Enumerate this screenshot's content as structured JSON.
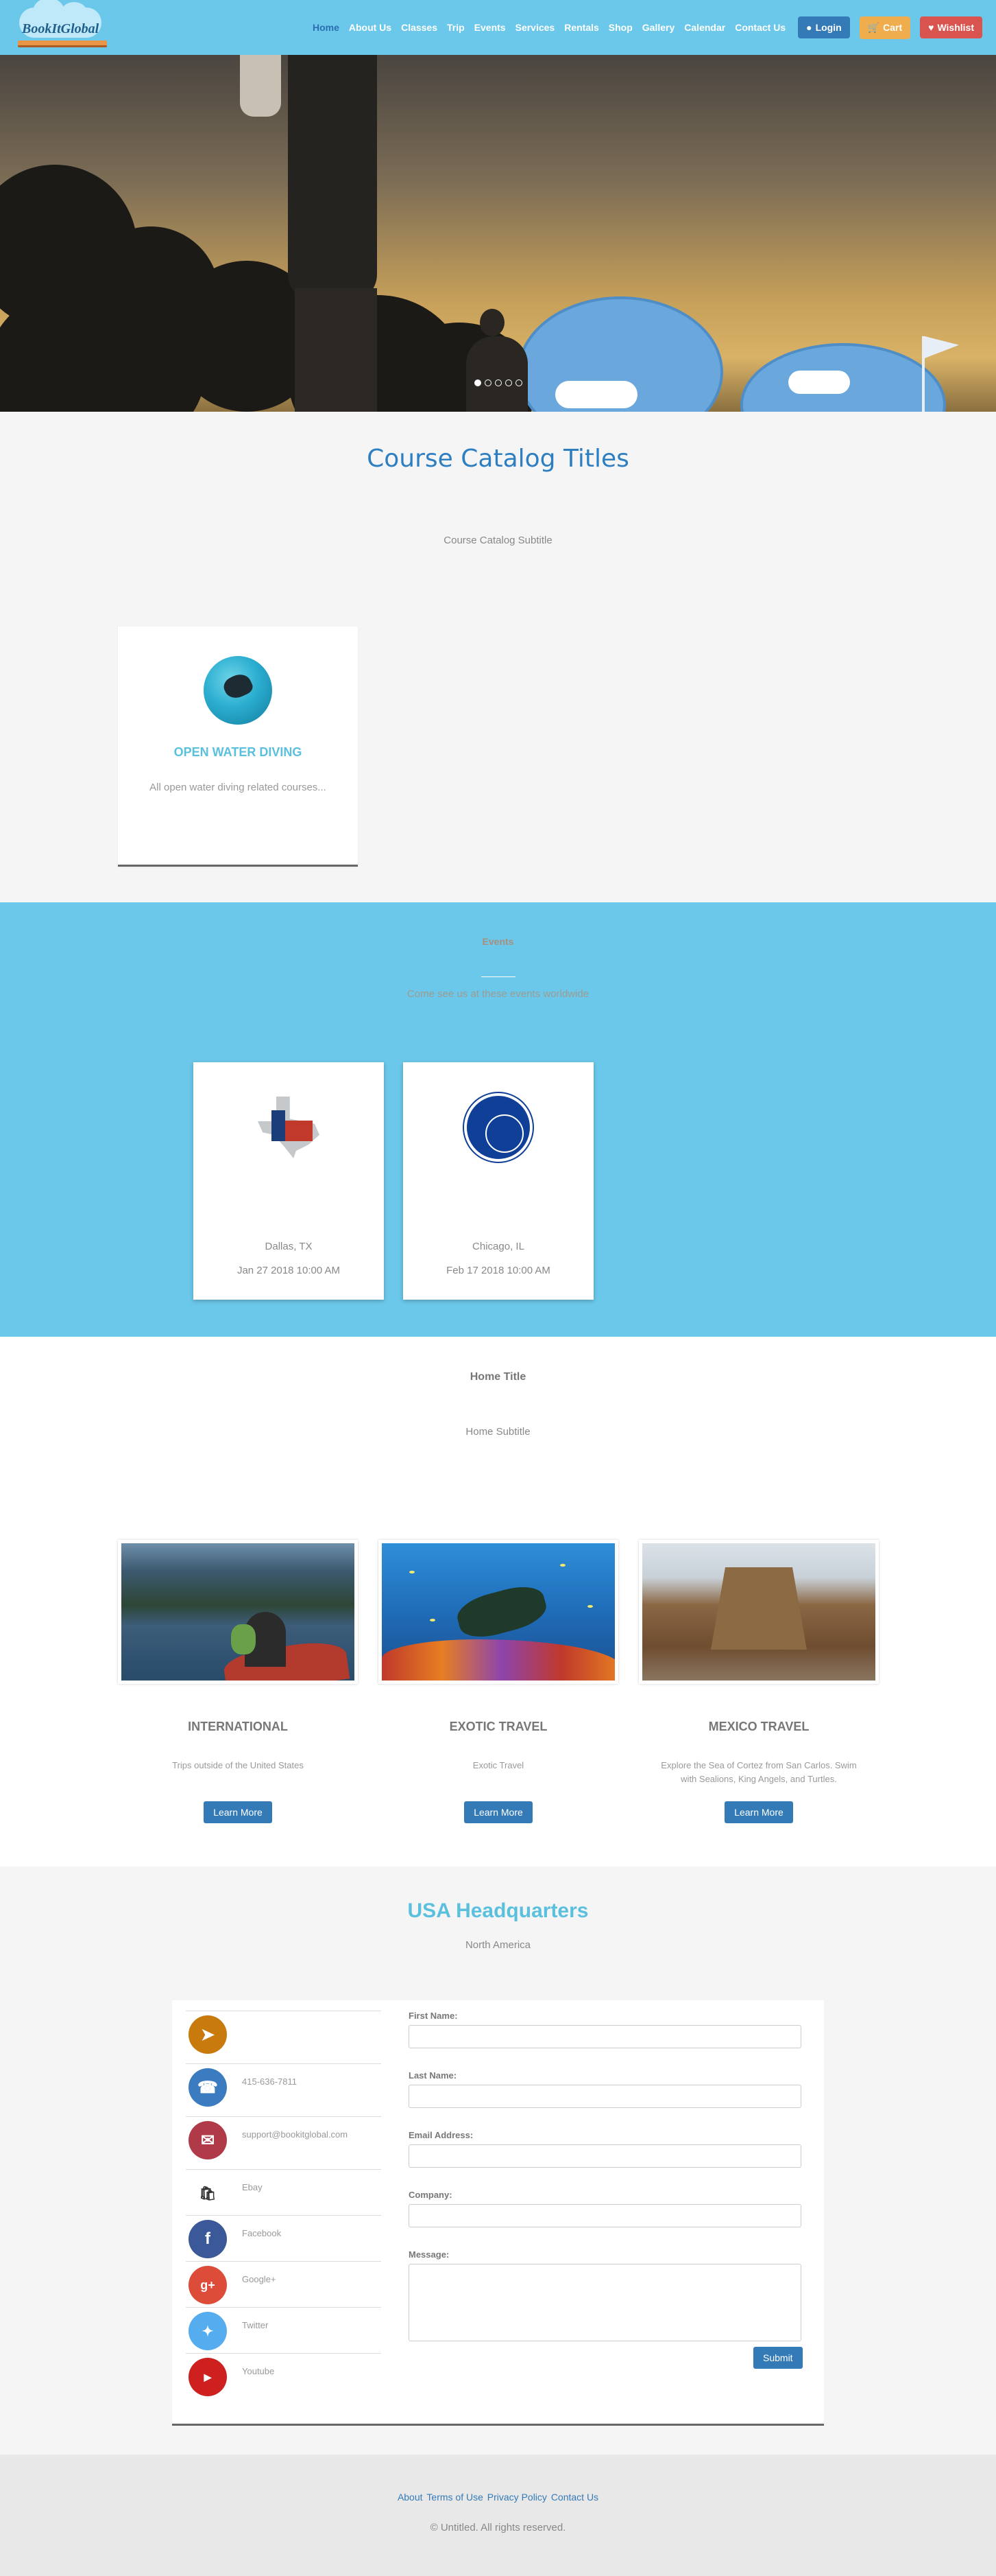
{
  "nav": {
    "logo_text": "BookItGlobal",
    "links": [
      "Home",
      "About Us",
      "Classes",
      "Trip",
      "Events",
      "Services",
      "Rentals",
      "Shop",
      "Gallery",
      "Calendar",
      "Contact Us"
    ],
    "login": "Login",
    "cart": "Cart",
    "wishlist": "Wishlist"
  },
  "catalog": {
    "title": "Course Catalog Titles",
    "subtitle": "Course Catalog Subtitle",
    "courses": [
      {
        "name": "OPEN WATER DIVING",
        "description": "All open water diving related courses..."
      }
    ]
  },
  "events": {
    "title": "Events",
    "subtitle": "Come see us at these events worldwide",
    "items": [
      {
        "city": "Dallas, TX",
        "date": "Jan 27 2018 10:00 AM"
      },
      {
        "city": "Chicago, IL",
        "date": "Feb 17 2018 10:00 AM"
      }
    ]
  },
  "home": {
    "title": "Home Title",
    "subtitle": "Home Subtitle",
    "items": [
      {
        "name": "INTERNATIONAL",
        "description": "Trips outside of the United States",
        "button": "Learn More"
      },
      {
        "name": "EXOTIC TRAVEL",
        "description": "Exotic Travel",
        "button": "Learn More"
      },
      {
        "name": "MEXICO TRAVEL",
        "description": "Explore the Sea of Cortez from San Carlos. Swim with Sealions, King Angels, and Turtles.",
        "button": "Learn More"
      }
    ]
  },
  "hq": {
    "title": "USA Headquarters",
    "subtitle": "North America",
    "contacts": [
      {
        "icon": "location-arrow-icon",
        "text": "",
        "color": "#e68a00"
      },
      {
        "icon": "phone-icon",
        "text": "415-636-7811",
        "color": "#3b7bbf"
      },
      {
        "icon": "envelope-icon",
        "text": "support@bookitglobal.com",
        "color": "#b03a48"
      },
      {
        "icon": "ebay-icon",
        "text": "Ebay",
        "color": "#ffffff"
      },
      {
        "icon": "facebook-icon",
        "text": "Facebook",
        "color": "#3b5998"
      },
      {
        "icon": "google-plus-icon",
        "text": "Google+",
        "color": "#dd4b39"
      },
      {
        "icon": "twitter-icon",
        "text": "Twitter",
        "color": "#55acee"
      },
      {
        "icon": "youtube-icon",
        "text": "Youtube",
        "color": "#cd201f"
      }
    ],
    "form": {
      "first_name_label": "First Name:",
      "last_name_label": "Last Name:",
      "email_label": "Email Address:",
      "company_label": "Company:",
      "message_label": "Message:",
      "submit": "Submit"
    }
  },
  "footer": {
    "links": [
      "About",
      "Terms of Use",
      "Privacy Policy",
      "Contact Us"
    ],
    "copyright": "© Untitled. All rights reserved."
  }
}
